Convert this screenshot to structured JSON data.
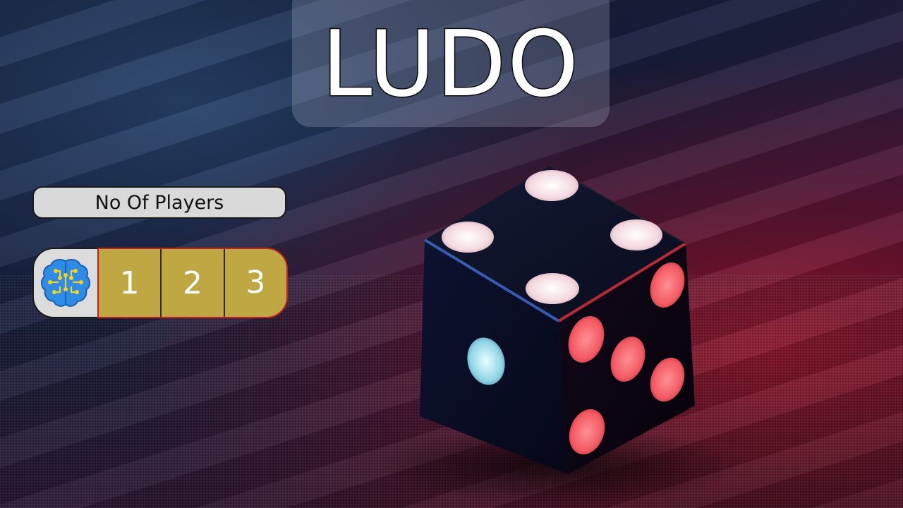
{
  "title": "LUDO",
  "players_label": "No Of Players",
  "player_options": [
    "1",
    "2",
    "3"
  ],
  "ai_button_icon": "brain-circuit-icon",
  "colors": {
    "option_fill": "#bfa743",
    "option_border": "#c0231e",
    "label_fill": "#d9d9d9",
    "brain_icon": "#2e8be6",
    "brain_circuit": "#f5d31a"
  }
}
